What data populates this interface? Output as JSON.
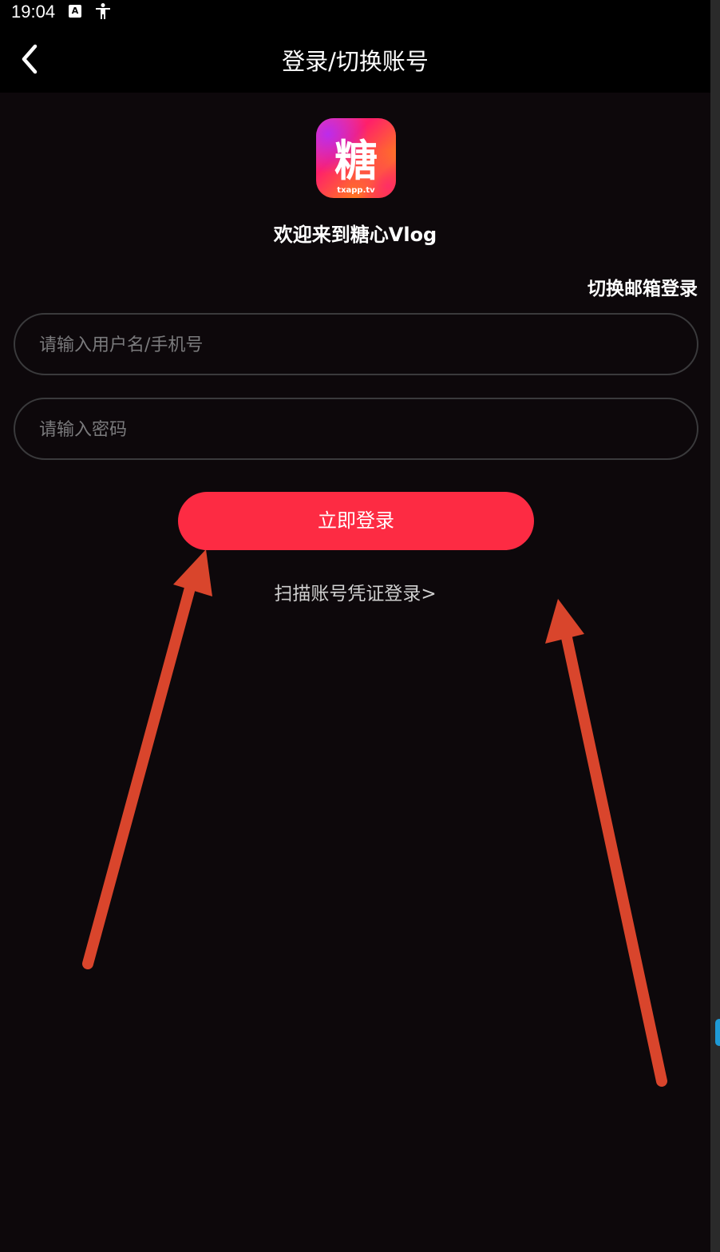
{
  "status_bar": {
    "time": "19:04",
    "icons": [
      "android-accessibility-a-icon",
      "accessibility-person-icon"
    ]
  },
  "header": {
    "title": "登录/切换账号",
    "back_icon": "chevron-left-icon"
  },
  "logo": {
    "glyph": "糖",
    "caption": "txapp.tv",
    "gradient": [
      "#ff2a8a",
      "#ff6a1a",
      "#a12bff"
    ]
  },
  "welcome_text": "欢迎来到糖心Vlog",
  "switch_email_login": "切换邮箱登录",
  "username_field": {
    "value": "",
    "placeholder": "请输入用户名/手机号"
  },
  "password_field": {
    "value": "",
    "placeholder": "请输入密码"
  },
  "login_button": {
    "label": "立即登录",
    "color": "#fd2b43"
  },
  "scan_login_link": "扫描账号凭证登录>",
  "annotations": {
    "arrow_color": "#d9452c"
  }
}
